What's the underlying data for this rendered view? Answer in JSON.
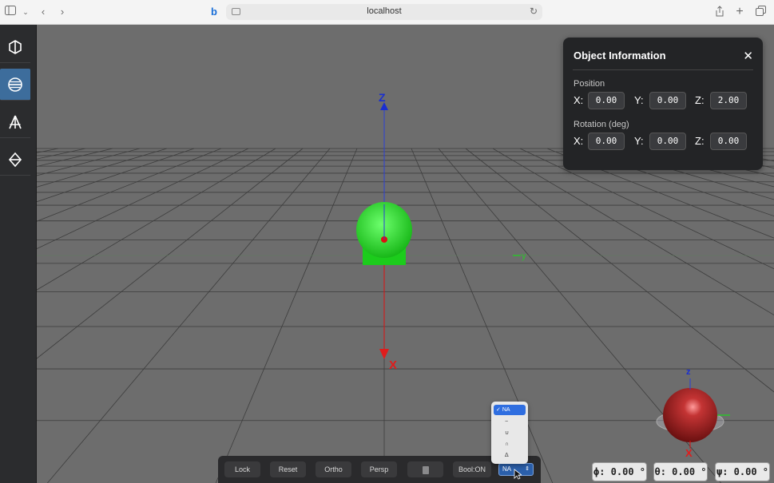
{
  "browser": {
    "url": "localhost"
  },
  "sidebar": {
    "tools": [
      {
        "name": "cube"
      },
      {
        "name": "cylinder"
      },
      {
        "name": "cone"
      },
      {
        "name": "octahedron"
      }
    ],
    "active_index": 1
  },
  "viewport": {
    "axis_labels": {
      "z": "Z",
      "x": "X",
      "y": "y"
    },
    "gizmo_labels": {
      "z": "z",
      "x": "X"
    },
    "object_color": "#1fcc1f",
    "gizmo_sphere_color": "#b31f1f"
  },
  "panel": {
    "title": "Object Information",
    "close": "✕",
    "position_label": "Position",
    "rotation_label": "Rotation (deg)",
    "position": {
      "x_label": "X:",
      "y_label": "Y:",
      "z_label": "Z:",
      "x": "0.00",
      "y": "0.00",
      "z": "2.00"
    },
    "rotation": {
      "x_label": "X:",
      "y_label": "Y:",
      "z_label": "Z:",
      "x": "0.00",
      "y": "0.00",
      "z": "0.00"
    }
  },
  "toolbar": {
    "lock": "Lock",
    "reset": "Reset",
    "ortho": "Ortho",
    "persp": "Persp",
    "bool": "Bool:ON",
    "select_value": "NA"
  },
  "dropdown": {
    "options": [
      "NA",
      "−",
      "∪",
      "∩",
      "Δ"
    ],
    "selected": "NA",
    "check": "✓"
  },
  "angles": {
    "phi": "ϕ: 0.00 °",
    "theta": "θ: 0.00 °",
    "psi": "ψ: 0.00 °"
  }
}
